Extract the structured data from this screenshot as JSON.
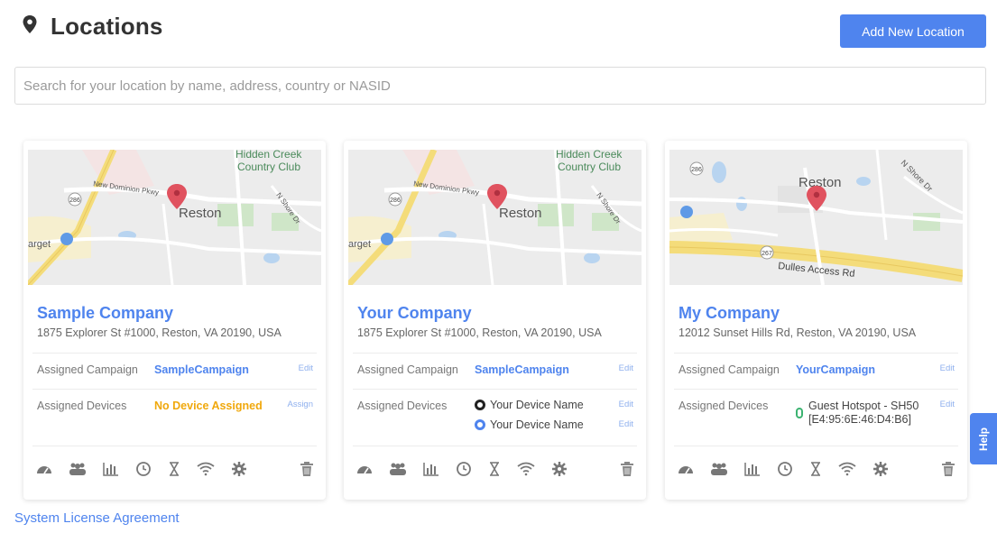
{
  "header": {
    "title": "Locations",
    "add_button": "Add New Location"
  },
  "search": {
    "placeholder": "Search for your location by name, address, country or NASID",
    "value": ""
  },
  "map_labels": {
    "hidden_creek_1": "Hidden Creek",
    "hidden_creek_2": "Country Club",
    "new_dominion": "New Dominion Pkwy",
    "reston": "Reston",
    "target": "arget",
    "n_shore": "N Shore Dr",
    "route_286": "286",
    "route_267": "267",
    "dulles": "Dulles Access Rd"
  },
  "cards": [
    {
      "name": "Sample Company",
      "address": "1875 Explorer St #1000, Reston, VA 20190, USA",
      "campaign_label": "Assigned Campaign",
      "campaign_value": "SampleCampaign",
      "campaign_action": "Edit",
      "devices_label": "Assigned Devices",
      "devices_value": "No Device Assigned",
      "devices_action": "Assign"
    },
    {
      "name": "Your Company",
      "address": "1875 Explorer St #1000, Reston, VA 20190, USA",
      "campaign_label": "Assigned Campaign",
      "campaign_value": "SampleCampaign",
      "campaign_action": "Edit",
      "devices_label": "Assigned Devices",
      "devices": [
        {
          "name": "Your Device Name",
          "action": "Edit"
        },
        {
          "name": "Your Device Name",
          "action": "Edit"
        }
      ]
    },
    {
      "name": "My Company",
      "address": "12012 Sunset Hills Rd, Reston, VA 20190, USA",
      "campaign_label": "Assigned Campaign",
      "campaign_value": "YourCampaign",
      "campaign_action": "Edit",
      "devices_label": "Assigned Devices",
      "device_line1": "Guest Hotspot - SH50",
      "device_line2": "[E4:95:6E:46:D4:B6]",
      "devices_action": "Edit"
    }
  ],
  "card_icons": [
    "dashboard-icon",
    "users-icon",
    "bar-chart-icon",
    "clock-icon",
    "hourglass-icon",
    "wifi-icon",
    "gear-icon",
    "trash-icon"
  ],
  "footer": {
    "license": "System License Agreement"
  },
  "help": "Help",
  "colors": {
    "accent": "#4f84ee",
    "warning": "#f0a80c",
    "map_pin": "#e0525f",
    "online": "#3cb371"
  }
}
